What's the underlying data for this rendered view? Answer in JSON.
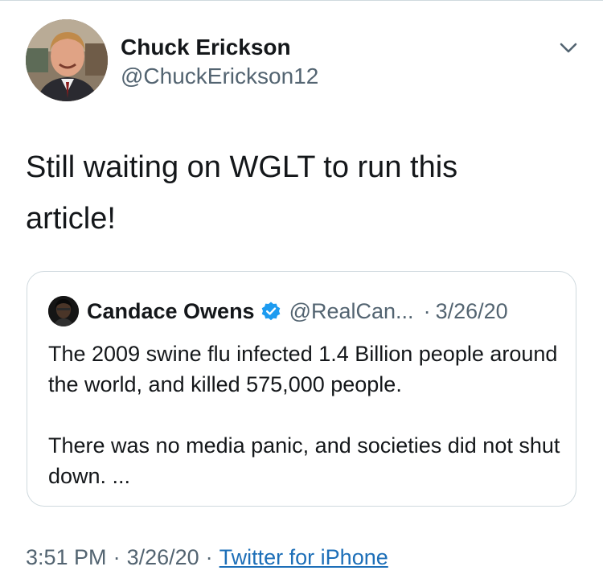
{
  "tweet": {
    "author": {
      "display_name": "Chuck Erickson",
      "handle": "@ChuckErickson12"
    },
    "menu_icon": "chevron-down-icon",
    "text_lines": [
      "Still waiting on WGLT to run this",
      "article!"
    ],
    "quoted": {
      "display_name": "Candace Owens",
      "verified_icon": "verified-badge-icon",
      "handle": "@RealCan...",
      "separator": "·",
      "date": "3/26/20",
      "paragraphs": [
        "The 2009 swine flu infected 1.4 Billion people around the world, and killed 575,000 people.",
        "There was no media panic, and societies did not shut down. ..."
      ]
    },
    "meta": {
      "time": "3:51 PM",
      "separator": "·",
      "date": "3/26/20",
      "source": "Twitter for iPhone"
    }
  },
  "colors": {
    "text_primary": "#14171a",
    "text_secondary": "#536471",
    "link": "#1d6fb8",
    "verified": "#1d9bf0",
    "border": "#cfd9de"
  }
}
